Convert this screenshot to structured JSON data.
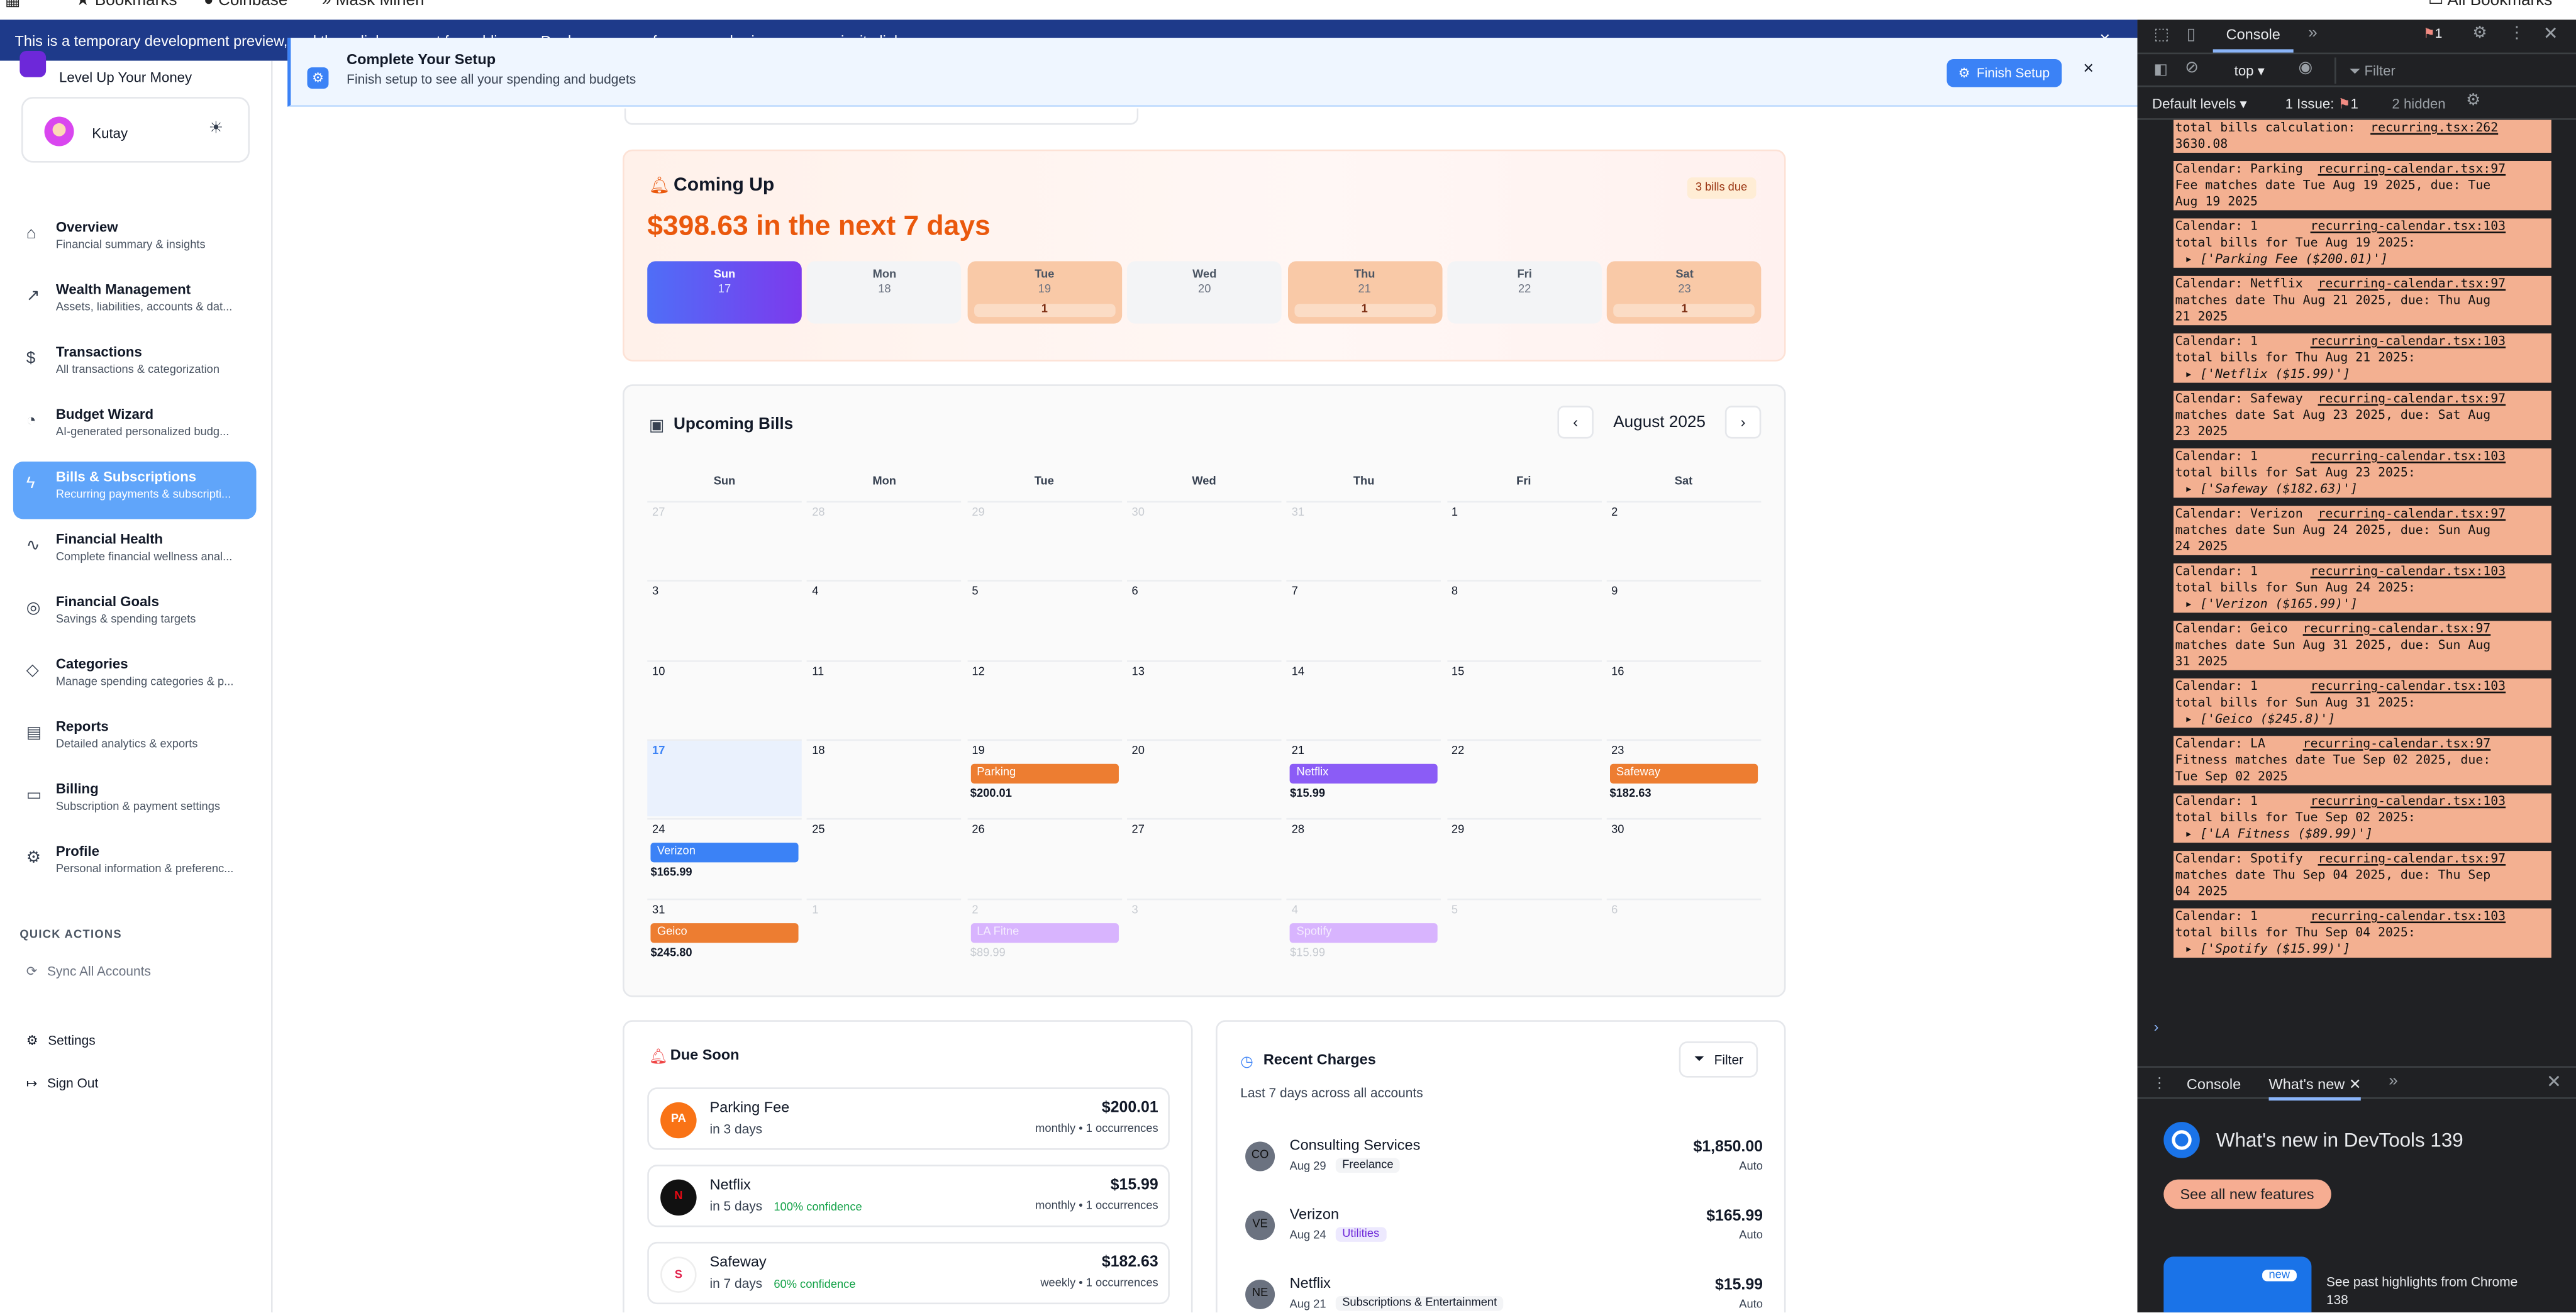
{
  "bookmarks_bar": {
    "items": [
      "Bookmarks",
      "Coinbase",
      "Mask Minerr",
      "All Bookmarks"
    ]
  },
  "banner": {
    "text_before": "This is a temporary development preview, and these links are not for public use.",
    "link": "Deploy your app",
    "text_after": "for secure sharing or use an invite link."
  },
  "setup": {
    "title": "Complete Your Setup",
    "subtitle": "Finish setup to see all your spending and budgets",
    "button": "Finish Setup"
  },
  "sidebar": {
    "tagline": "Level Up Your Money",
    "user": {
      "name": "Kutay"
    },
    "nav": [
      {
        "title": "Overview",
        "sub": "Financial summary & insights",
        "icon": "home-icon"
      },
      {
        "title": "Wealth Management",
        "sub": "Assets, liabilities, accounts & dat...",
        "icon": "trend-icon"
      },
      {
        "title": "Transactions",
        "sub": "All transactions & categorization",
        "icon": "dollar-icon"
      },
      {
        "title": "Budget Wizard",
        "sub": "AI-generated personalized budg...",
        "icon": "gauge-icon"
      },
      {
        "title": "Bills & Subscriptions",
        "sub": "Recurring payments & subscripti...",
        "icon": "zap-icon"
      },
      {
        "title": "Financial Health",
        "sub": "Complete financial wellness anal...",
        "icon": "pulse-icon"
      },
      {
        "title": "Financial Goals",
        "sub": "Savings & spending targets",
        "icon": "target-icon"
      },
      {
        "title": "Categories",
        "sub": "Manage spending categories & p...",
        "icon": "tag-icon"
      },
      {
        "title": "Reports",
        "sub": "Detailed analytics & exports",
        "icon": "file-icon"
      },
      {
        "title": "Billing",
        "sub": "Subscription & payment settings",
        "icon": "card-icon"
      },
      {
        "title": "Profile",
        "sub": "Personal information & preferenc...",
        "icon": "gear-icon"
      }
    ],
    "quick_actions_title": "QUICK ACTIONS",
    "sync": "Sync All Accounts",
    "settings": "Settings",
    "sign_out": "Sign Out"
  },
  "coming_up": {
    "title": "Coming Up",
    "badge": "3 bills due",
    "amount": "$398.63 in the next 7 days",
    "days": [
      {
        "name": "Sun",
        "date": "17",
        "count": "",
        "style": "today"
      },
      {
        "name": "Mon",
        "date": "18",
        "count": "",
        "style": "none"
      },
      {
        "name": "Tue",
        "date": "19",
        "count": "1",
        "style": "due"
      },
      {
        "name": "Wed",
        "date": "20",
        "count": "",
        "style": "none"
      },
      {
        "name": "Thu",
        "date": "21",
        "count": "1",
        "style": "due"
      },
      {
        "name": "Fri",
        "date": "22",
        "count": "",
        "style": "none"
      },
      {
        "name": "Sat",
        "date": "23",
        "count": "1",
        "style": "due"
      }
    ]
  },
  "upcoming_bills": {
    "title": "Upcoming Bills",
    "month": "August 2025",
    "weekdays": [
      "Sun",
      "Mon",
      "Tue",
      "Wed",
      "Thu",
      "Fri",
      "Sat"
    ],
    "weeks": [
      [
        {
          "d": "27",
          "dim": true
        },
        {
          "d": "28",
          "dim": true
        },
        {
          "d": "29",
          "dim": true
        },
        {
          "d": "30",
          "dim": true
        },
        {
          "d": "31",
          "dim": true
        },
        {
          "d": "1"
        },
        {
          "d": "2"
        }
      ],
      [
        {
          "d": "3"
        },
        {
          "d": "4"
        },
        {
          "d": "5"
        },
        {
          "d": "6"
        },
        {
          "d": "7"
        },
        {
          "d": "8"
        },
        {
          "d": "9"
        }
      ],
      [
        {
          "d": "10"
        },
        {
          "d": "11"
        },
        {
          "d": "12"
        },
        {
          "d": "13"
        },
        {
          "d": "14"
        },
        {
          "d": "15"
        },
        {
          "d": "16"
        }
      ],
      [
        {
          "d": "17",
          "today": true
        },
        {
          "d": "18"
        },
        {
          "d": "19",
          "bill": "Parking",
          "amount": "$200.01",
          "color": "#ed7d31"
        },
        {
          "d": "20"
        },
        {
          "d": "21",
          "bill": "Netflix",
          "amount": "$15.99",
          "color": "#8b5cf6"
        },
        {
          "d": "22"
        },
        {
          "d": "23",
          "bill": "Safeway",
          "amount": "$182.63",
          "color": "#ed7d31"
        }
      ],
      [
        {
          "d": "24",
          "bill": "Verizon",
          "amount": "$165.99",
          "color": "#3b82f6"
        },
        {
          "d": "25"
        },
        {
          "d": "26"
        },
        {
          "d": "27"
        },
        {
          "d": "28"
        },
        {
          "d": "29"
        },
        {
          "d": "30"
        }
      ],
      [
        {
          "d": "31",
          "bill": "Geico",
          "amount": "$245.80",
          "color": "#ed7d31"
        },
        {
          "d": "1",
          "dim": true
        },
        {
          "d": "2",
          "dim": true,
          "bill": "LA Fitne",
          "amount": "$89.99",
          "color": "#d8b4fe"
        },
        {
          "d": "3",
          "dim": true
        },
        {
          "d": "4",
          "dim": true,
          "bill": "Spotify",
          "amount": "$15.99",
          "color": "#d8b4fe"
        },
        {
          "d": "5",
          "dim": true
        },
        {
          "d": "6",
          "dim": true
        }
      ]
    ]
  },
  "due_soon": {
    "title": "Due Soon",
    "items": [
      {
        "logo": "PA",
        "name": "Parking Fee",
        "when": "in 3 days",
        "confidence": "",
        "amount": "$200.01",
        "freq": "monthly • 1 occurrences"
      },
      {
        "logo": "N",
        "name": "Netflix",
        "when": "in 5 days",
        "confidence": "100% confidence",
        "amount": "$15.99",
        "freq": "monthly • 1 occurrences"
      },
      {
        "logo": "S",
        "name": "Safeway",
        "when": "in 7 days",
        "confidence": "60% confidence",
        "amount": "$182.63",
        "freq": "weekly • 1 occurrences"
      }
    ]
  },
  "recent_charges": {
    "title": "Recent Charges",
    "filter": "Filter",
    "subtitle": "Last 7 days across all accounts",
    "items": [
      {
        "logo": "CO",
        "name": "Consulting Services",
        "date": "Aug 29",
        "tag": "Freelance",
        "amount": "$1,850.00",
        "mode": "Auto"
      },
      {
        "logo": "VE",
        "name": "Verizon",
        "date": "Aug 24",
        "tag": "Utilities",
        "amount": "$165.99",
        "mode": "Auto"
      },
      {
        "logo": "NE",
        "name": "Netflix",
        "date": "Aug 21",
        "tag": "Subscriptions & Entertainment",
        "amount": "$15.99",
        "mode": "Auto"
      }
    ]
  },
  "devtools": {
    "tab": "Console",
    "issues_badge": "1",
    "context": "top",
    "filter_placeholder": "Filter",
    "levels": "Default levels",
    "issues_text": "1 Issue:",
    "issues_count": "1",
    "hidden": "2 hidden",
    "logs": [
      {
        "lines": [
          "total bills calculation:  ",
          "3630.08"
        ],
        "link": "recurring.tsx:262"
      },
      {
        "lines": [
          "Calendar: Parking  ",
          "Fee matches date Tue Aug 19 2025, due: Tue",
          "Aug 19 2025"
        ],
        "link": "recurring-calendar.tsx:97"
      },
      {
        "lines": [
          "Calendar: 1       ",
          "total bills for Tue Aug 19 2025:"
        ],
        "link": "recurring-calendar.tsx:103",
        "array": "['Parking Fee ($200.01)']"
      },
      {
        "lines": [
          "Calendar: Netflix  ",
          "matches date Thu Aug 21 2025, due: Thu Aug",
          "21 2025"
        ],
        "link": "recurring-calendar.tsx:97"
      },
      {
        "lines": [
          "Calendar: 1       ",
          "total bills for Thu Aug 21 2025:"
        ],
        "link": "recurring-calendar.tsx:103",
        "array": "['Netflix ($15.99)']"
      },
      {
        "lines": [
          "Calendar: Safeway  ",
          "matches date Sat Aug 23 2025, due: Sat Aug",
          "23 2025"
        ],
        "link": "recurring-calendar.tsx:97"
      },
      {
        "lines": [
          "Calendar: 1       ",
          "total bills for Sat Aug 23 2025:"
        ],
        "link": "recurring-calendar.tsx:103",
        "array": "['Safeway ($182.63)']"
      },
      {
        "lines": [
          "Calendar: Verizon  ",
          "matches date Sun Aug 24 2025, due: Sun Aug",
          "24 2025"
        ],
        "link": "recurring-calendar.tsx:97"
      },
      {
        "lines": [
          "Calendar: 1       ",
          "total bills for Sun Aug 24 2025:"
        ],
        "link": "recurring-calendar.tsx:103",
        "array": "['Verizon ($165.99)']"
      },
      {
        "lines": [
          "Calendar: Geico  ",
          "matches date Sun Aug 31 2025, due: Sun Aug",
          "31 2025"
        ],
        "link": "recurring-calendar.tsx:97"
      },
      {
        "lines": [
          "Calendar: 1       ",
          "total bills for Sun Aug 31 2025:"
        ],
        "link": "recurring-calendar.tsx:103",
        "array": "['Geico ($245.8)']"
      },
      {
        "lines": [
          "Calendar: LA     ",
          "Fitness matches date Tue Sep 02 2025, due:",
          "Tue Sep 02 2025"
        ],
        "link": "recurring-calendar.tsx:97"
      },
      {
        "lines": [
          "Calendar: 1       ",
          "total bills for Tue Sep 02 2025:"
        ],
        "link": "recurring-calendar.tsx:103",
        "array": "['LA Fitness ($89.99)']"
      },
      {
        "lines": [
          "Calendar: Spotify  ",
          "matches date Thu Sep 04 2025, due: Thu Sep",
          "04 2025"
        ],
        "link": "recurring-calendar.tsx:97"
      },
      {
        "lines": [
          "Calendar: 1       ",
          "total bills for Thu Sep 04 2025:"
        ],
        "link": "recurring-calendar.tsx:103",
        "array": "['Spotify ($15.99)']"
      }
    ],
    "drawer_tabs": [
      "Console",
      "What's new"
    ],
    "whats_new_title": "What's new in DevTools 139",
    "see_all": "See all new features",
    "new_badge": "new",
    "highlights": "See past highlights from Chrome 138"
  },
  "colors": {
    "banner": "#1e3a8a",
    "active_nav": "#60a5fa",
    "devtools_bg": "#202124",
    "log_bg": "#f3b091",
    "accent_orange": "#ed7d31"
  }
}
